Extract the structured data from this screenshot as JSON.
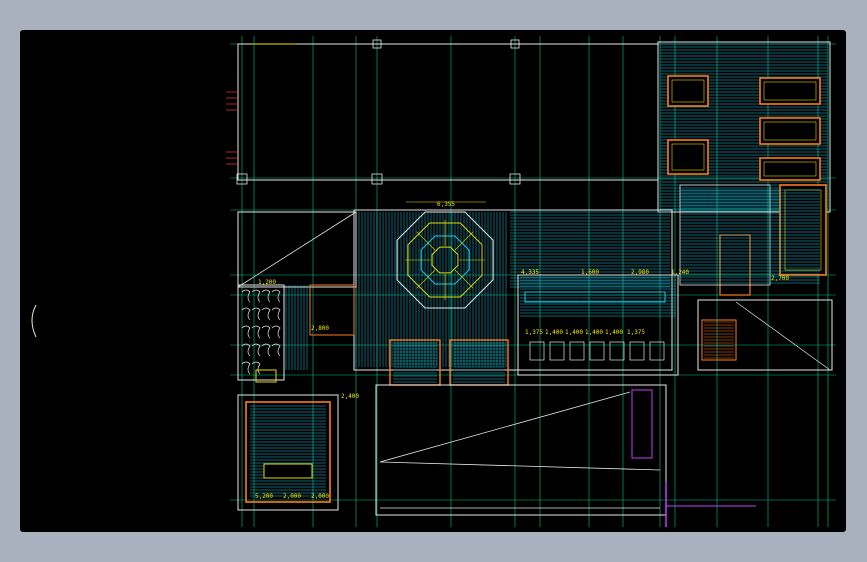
{
  "viewport": {
    "background": "#000000",
    "frame_color": "#a9b1be"
  },
  "colors": {
    "wall": "#e6e6e6",
    "grid": "#00c28a",
    "hatch_cyan": "#1ec8e6",
    "dimension": "#f2e600",
    "furniture": "#e8d800",
    "accent_orange": "#ff7a1a",
    "accent_magenta": "#c83cff",
    "accent_red": "#e03030"
  },
  "dimensions": {
    "top_hall": "6,355",
    "row_a": [
      "4,335",
      "1,600",
      "2,980",
      "1,240"
    ],
    "row_b": [
      "1,375",
      "1,400",
      "1,400",
      "1,400",
      "1,400",
      "1,375"
    ],
    "left_a": "2,800",
    "left_b": "2,400",
    "left_c": "1,200",
    "bottom_room": [
      "5,200",
      "2,000",
      "2,000"
    ],
    "right_block": "2,700"
  }
}
